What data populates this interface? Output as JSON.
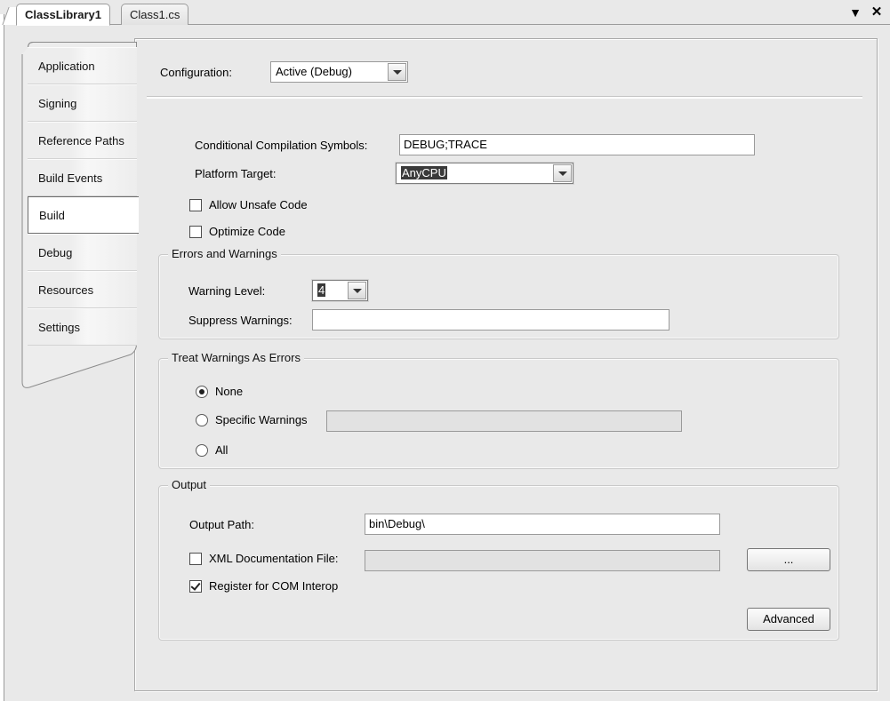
{
  "window": {
    "dropdown_icon": "chevron-down-icon",
    "close_icon": "close-icon",
    "dropdown_glyph": "▼",
    "close_glyph": "✕"
  },
  "tabs": [
    {
      "label": "ClassLibrary1",
      "active": true
    },
    {
      "label": "Class1.cs",
      "active": false
    }
  ],
  "sidebar": {
    "items": [
      {
        "label": "Application",
        "selected": false
      },
      {
        "label": "Signing",
        "selected": false
      },
      {
        "label": "Reference Paths",
        "selected": false
      },
      {
        "label": "Build Events",
        "selected": false
      },
      {
        "label": "Build",
        "selected": true
      },
      {
        "label": "Debug",
        "selected": false
      },
      {
        "label": "Resources",
        "selected": false
      },
      {
        "label": "Settings",
        "selected": false
      }
    ]
  },
  "configuration": {
    "label": "Configuration:",
    "value": "Active (Debug)"
  },
  "general": {
    "conditional_symbols_label": "Conditional Compilation Symbols:",
    "conditional_symbols_value": "DEBUG;TRACE",
    "platform_target_label": "Platform Target:",
    "platform_target_value": "AnyCPU",
    "allow_unsafe_label": "Allow Unsafe Code",
    "allow_unsafe_checked": false,
    "optimize_label": "Optimize Code",
    "optimize_checked": false
  },
  "errors_warnings": {
    "title": "Errors and Warnings",
    "warning_level_label": "Warning Level:",
    "warning_level_value": "4",
    "suppress_warnings_label": "Suppress Warnings:",
    "suppress_warnings_value": ""
  },
  "treat_warnings": {
    "title": "Treat Warnings As Errors",
    "options": [
      {
        "label": "None",
        "selected": true
      },
      {
        "label": "Specific Warnings",
        "selected": false
      },
      {
        "label": "All",
        "selected": false
      }
    ],
    "specific_warnings_value": ""
  },
  "output": {
    "title": "Output",
    "output_path_label": "Output Path:",
    "output_path_value": "bin\\Debug\\",
    "browse_label": "...",
    "xml_doc_label": "XML Documentation File:",
    "xml_doc_checked": false,
    "xml_doc_value": "",
    "com_interop_label": "Register for COM Interop",
    "com_interop_checked": true,
    "advanced_label": "Advanced"
  },
  "colors": {
    "window_bg": "#e9e9e9",
    "panel_bg": "#e9e9e9",
    "selection": "#3a3a3a",
    "border": "#9a9a9a",
    "active_tab": "#ffffff"
  }
}
